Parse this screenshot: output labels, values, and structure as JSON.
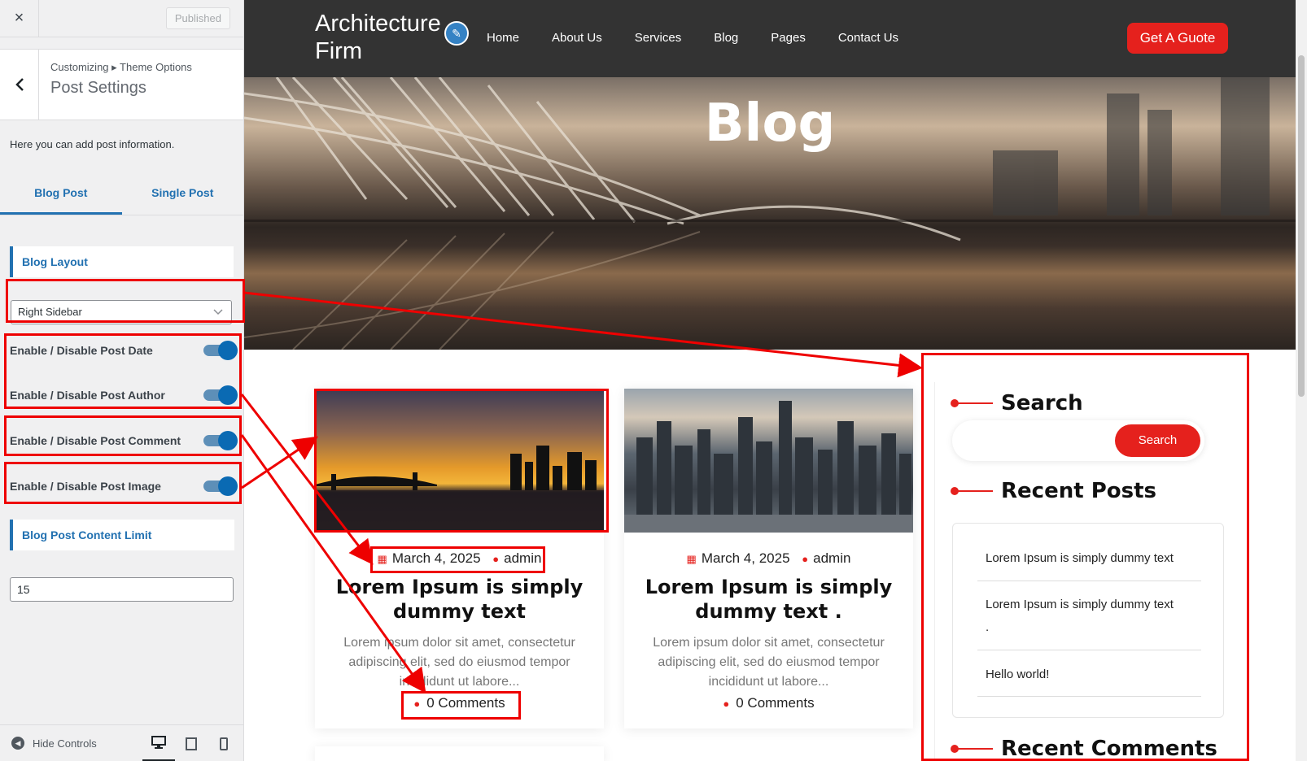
{
  "customizer": {
    "close_icon": "×",
    "published_label": "Published",
    "breadcrumb": "Customizing ▸ Theme Options",
    "title": "Post Settings",
    "description": "Here you can add post information.",
    "tabs": [
      "Blog Post",
      "Single Post"
    ],
    "blog_layout_heading": "Blog Layout",
    "layout_select_value": "Right Sidebar",
    "toggles": [
      {
        "label": "Enable / Disable Post Date",
        "on": true
      },
      {
        "label": "Enable / Disable Post Author",
        "on": true
      },
      {
        "label": "Enable / Disable Post Comment",
        "on": true
      },
      {
        "label": "Enable / Disable Post Image",
        "on": true
      }
    ],
    "content_limit_heading": "Blog Post Content Limit",
    "content_limit_value": "15",
    "hide_controls_label": "Hide Controls"
  },
  "site": {
    "logo_text": "Architecture Firm",
    "nav": [
      "Home",
      "About Us",
      "Services",
      "Blog",
      "Pages",
      "Contact Us"
    ],
    "cta_label": "Get A Guote",
    "hero_title": "Blog",
    "posts": [
      {
        "date": "March 4, 2025",
        "author": "admin",
        "title": "Lorem Ipsum is simply dummy text",
        "excerpt": "Lorem ipsum dolor sit amet, consectetur adipiscing elit, sed do eiusmod tempor incididunt ut labore...",
        "comments": "0 Comments"
      },
      {
        "date": "March 4, 2025",
        "author": "admin",
        "title": "Lorem Ipsum is simply dummy text .",
        "excerpt": "Lorem ipsum dolor sit amet, consectetur adipiscing elit, sed do eiusmod tempor incididunt ut labore...",
        "comments": "0 Comments"
      }
    ],
    "sidebar": {
      "search_title": "Search",
      "search_button": "Search",
      "recent_posts_title": "Recent Posts",
      "recent_posts": [
        "Lorem Ipsum is simply dummy text",
        "Lorem Ipsum is simply dummy text",
        ".",
        "Hello world!"
      ],
      "recent_comments_title": "Recent Comments"
    }
  },
  "colors": {
    "accent": "#e5211d",
    "wp_blue": "#2271b1",
    "annotation": "#ee0000"
  }
}
